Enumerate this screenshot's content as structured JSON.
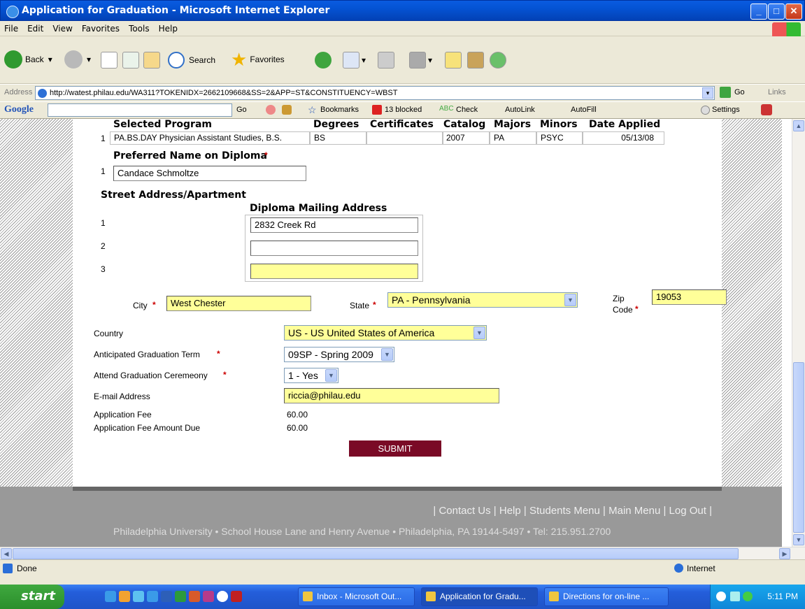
{
  "window": {
    "title": "Application for Graduation - Microsoft Internet Explorer"
  },
  "menu": [
    "File",
    "Edit",
    "View",
    "Favorites",
    "Tools",
    "Help"
  ],
  "toolbar": {
    "back": "Back",
    "search": "Search",
    "favorites": "Favorites"
  },
  "address": {
    "label": "Address",
    "url": "http://watest.philau.edu/WA311?TOKENIDX=2662109668&SS=2&APP=ST&CONSTITUENCY=WBST",
    "go": "Go",
    "links": "Links"
  },
  "googlebar": {
    "logo": "Google",
    "go": "Go",
    "bookmarks": "Bookmarks",
    "blocked": "13 blocked",
    "check": "Check",
    "autolink": "AutoLink",
    "autofill": "AutoFill",
    "settings": "Settings"
  },
  "program": {
    "headers": [
      "Selected Program",
      "Degrees",
      "Certificates",
      "Catalog",
      "Majors",
      "Minors",
      "Date Applied"
    ],
    "row": {
      "num": "1",
      "program": "PA.BS.DAY Physician Assistant Studies, B.S.",
      "degree": "BS",
      "certificate": "",
      "catalog": "2007",
      "major": "PA",
      "minor": "PSYC",
      "date": "05/13/08"
    }
  },
  "diploma_name": {
    "label": "Preferred Name on Diploma",
    "num": "1",
    "value": "Candace Schmoltze"
  },
  "street": {
    "label": "Street Address/Apartment",
    "mailing_label": "Diploma Mailing Address",
    "lines": [
      {
        "num": "1",
        "value": "2832 Creek Rd"
      },
      {
        "num": "2",
        "value": ""
      },
      {
        "num": "3",
        "value": ""
      }
    ]
  },
  "city": {
    "label": "City",
    "value": "West Chester"
  },
  "state": {
    "label": "State",
    "value": "PA - Pennsylvania"
  },
  "zip": {
    "label1": "Zip",
    "label2": "Code",
    "value": "19053"
  },
  "country": {
    "label": "Country",
    "value": "US - US United States of America"
  },
  "term": {
    "label": "Anticipated Graduation Term",
    "value": "09SP - Spring 2009"
  },
  "ceremony": {
    "label": "Attend Graduation Ceremeony",
    "value": "1 - Yes"
  },
  "email": {
    "label": "E-mail Address",
    "value": "riccia@philau.edu"
  },
  "fee": {
    "label": "Application Fee",
    "value": "60.00"
  },
  "fee_due": {
    "label": "Application Fee Amount Due",
    "value": "60.00"
  },
  "submit": "SUBMIT",
  "footer": {
    "links": [
      "Contact Us",
      "Help",
      "Students Menu",
      "Main Menu",
      "Log Out"
    ],
    "address": "Philadelphia University • School House Lane and Henry Avenue • Philadelphia, PA 19144-5497 • Tel: 215.951.2700"
  },
  "status": {
    "text": "Done",
    "zone": "Internet"
  },
  "taskbar": {
    "start": "start",
    "tasks": [
      "Inbox - Microsoft Out...",
      "Application for Gradu...",
      "Directions for on-line ..."
    ],
    "clock": "5:11 PM"
  }
}
